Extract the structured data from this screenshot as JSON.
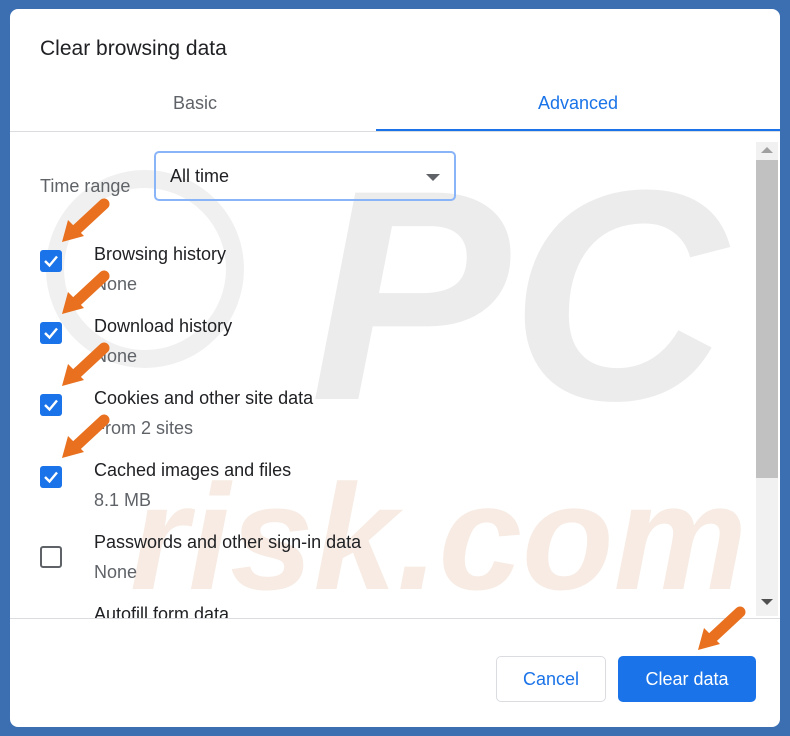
{
  "dialog": {
    "title": "Clear browsing data"
  },
  "tabs": [
    {
      "label": "Basic",
      "active": false
    },
    {
      "label": "Advanced",
      "active": true
    }
  ],
  "time_range": {
    "label": "Time range",
    "value": "All time"
  },
  "items": [
    {
      "label": "Browsing history",
      "sub": "None",
      "checked": true
    },
    {
      "label": "Download history",
      "sub": "None",
      "checked": true
    },
    {
      "label": "Cookies and other site data",
      "sub": "From 2 sites",
      "checked": true
    },
    {
      "label": "Cached images and files",
      "sub": "8.1 MB",
      "checked": true
    },
    {
      "label": "Passwords and other sign-in data",
      "sub": "None",
      "checked": false
    },
    {
      "label": "Autofill form data",
      "sub": "",
      "checked": false
    }
  ],
  "buttons": {
    "cancel": "Cancel",
    "clear": "Clear data"
  },
  "colors": {
    "accent": "#1a73e8",
    "frame": "#3b6fb2",
    "annotation_arrow": "#e8701f"
  },
  "watermark": {
    "text_top": "PC",
    "text_bottom": "risk.com"
  }
}
